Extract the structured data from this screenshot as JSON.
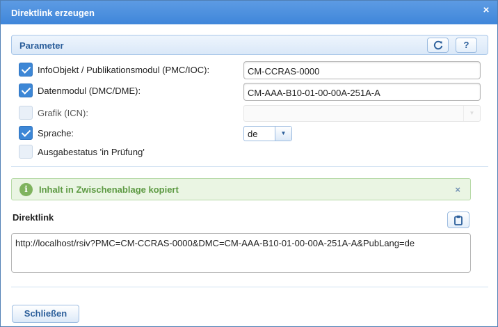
{
  "window": {
    "title": "Direktlink erzeugen",
    "close_icon": "×"
  },
  "parameter_panel": {
    "title": "Parameter",
    "refresh_icon": "⟳",
    "help_label": "?"
  },
  "parameters": {
    "pmc": {
      "label": "InfoObjekt / Publikationsmodul (PMC/IOC):",
      "checked": true,
      "value": "CM-CCRAS-0000"
    },
    "dmc": {
      "label": "Datenmodul (DMC/DME):",
      "checked": true,
      "value": "CM-AAA-B10-01-00-00A-251A-A"
    },
    "icn": {
      "label": "Grafik (ICN):",
      "checked": false,
      "value": ""
    },
    "language": {
      "label": "Sprache:",
      "checked": true,
      "value": "de"
    },
    "status": {
      "label": "Ausgabestatus 'in Prüfung'",
      "checked": false
    }
  },
  "notification": {
    "icon": "i",
    "message": "Inhalt in Zwischenablage kopiert",
    "close_icon": "×"
  },
  "direktlink": {
    "label": "Direktlink",
    "value": "http://localhost/rsiv?PMC=CM-CCRAS-0000&DMC=CM-AAA-B10-01-00-00A-251A-A&PubLang=de"
  },
  "footer": {
    "close_label": "Schließen"
  },
  "colors": {
    "titlebar": "#4a8fdf",
    "accent": "#2c5f9b",
    "checkbox_checked": "#3d87d6",
    "success_bg": "#eaf5e3",
    "success_text": "#5d9a43"
  }
}
